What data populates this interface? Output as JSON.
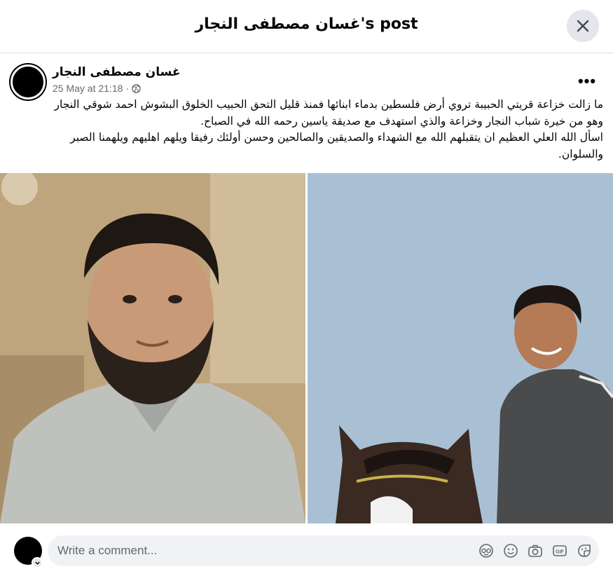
{
  "header": {
    "title": "غسان مصطفى النجار's post"
  },
  "post": {
    "author": "غسان مصطفى النجار",
    "timestamp": "25 May at 21:18",
    "separator": "·",
    "text_line1": "ما زالت خزاعة قريتي الحبيبة تروي أرض فلسطين بدماء ابنائها فمنذ قليل التحق الحبيب الخلوق البشوش احمد شوقي النجار وهو من خيرة شباب النجار وخزاعة والذي استهدف مع صديقة ياسين رحمه الله في الصباح.",
    "text_line2": "اسأل الله العلي العظيم ان يتقبلهم الله مع الشهداء والصديقين والصالحين وحسن أولئك رفيقا ويلهم اهليهم ويلهمنا الصبر والسلوان.",
    "more_label": "•••"
  },
  "comment": {
    "placeholder": "Write a comment..."
  },
  "icons": {
    "close": "close-icon",
    "globe": "globe-icon",
    "avatar_sticker": "avatar-sticker-icon",
    "emoji": "emoji-icon",
    "camera": "camera-icon",
    "gif": "gif-icon",
    "sticker": "sticker-icon"
  },
  "colors": {
    "secondary_text": "#65676b",
    "input_bg": "#f0f2f5",
    "button_bg": "#e4e6eb"
  }
}
